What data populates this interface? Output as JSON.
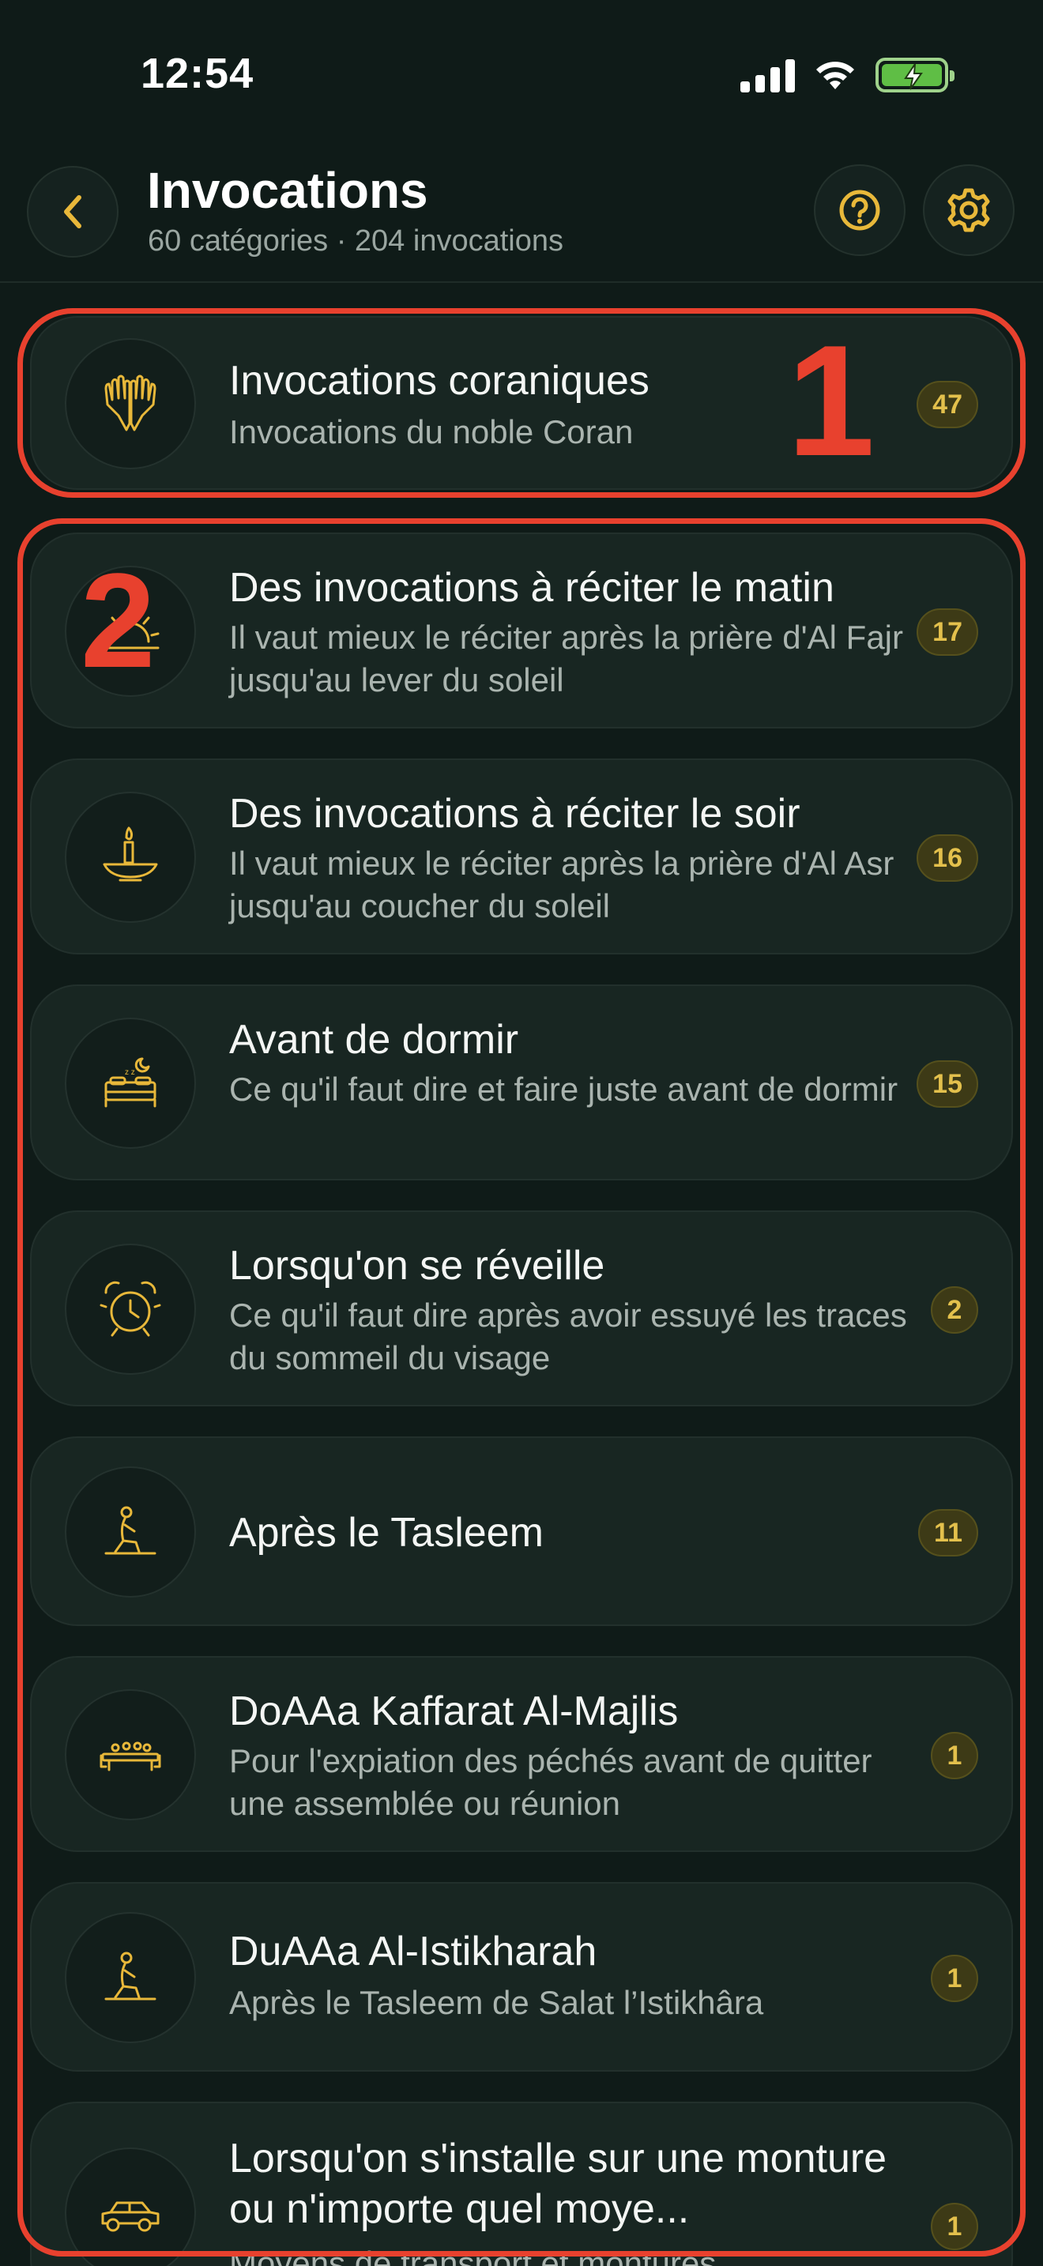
{
  "status_bar": {
    "time": "12:54"
  },
  "header": {
    "title": "Invocations",
    "subtitle": "60 catégories · 204 invocations"
  },
  "colors": {
    "accent": "#e8b83a",
    "annotation": "#e8412e",
    "background": "#0f1b18",
    "card": "#182622"
  },
  "annotations": {
    "box1": "1",
    "box2": "2"
  },
  "categories": [
    {
      "title": "Invocations coraniques",
      "description": "Invocations du noble Coran",
      "count": "47",
      "icon": "raised-hands-icon"
    },
    {
      "title": "Des invocations à réciter le matin",
      "description": "Il vaut mieux le réciter après la prière d'Al Fajr jusqu'au lever du soleil",
      "count": "17",
      "icon": "sunrise-icon"
    },
    {
      "title": "Des invocations à réciter le soir",
      "description": "Il vaut mieux le réciter après la prière d'Al Asr jusqu'au coucher du soleil",
      "count": "16",
      "icon": "oil-lamp-icon"
    },
    {
      "title": "Avant de dormir",
      "description": "Ce qu'il faut dire et faire juste avant de dormir",
      "count": "15",
      "icon": "bed-icon"
    },
    {
      "title": "Lorsqu'on se réveille",
      "description": "Ce qu'il faut dire après avoir essuyé les traces du sommeil du visage",
      "count": "2",
      "icon": "alarm-clock-icon"
    },
    {
      "title": "Après le Tasleem",
      "description": "",
      "count": "11",
      "icon": "praying-person-icon"
    },
    {
      "title": "DoAAa Kaffarat Al-Majlis",
      "description": "Pour l'expiation des péchés avant de quitter une assemblée ou réunion",
      "count": "1",
      "icon": "assembly-table-icon"
    },
    {
      "title": "DuAAa Al-Istikharah",
      "description": "Après le Tasleem de Salat l’Istikhâra",
      "count": "1",
      "icon": "praying-person-icon"
    },
    {
      "title": "Lorsqu'on s'installe sur une monture ou n'importe quel moye...",
      "description": "Moyens de transport et montures",
      "count": "1",
      "icon": "car-icon"
    }
  ]
}
